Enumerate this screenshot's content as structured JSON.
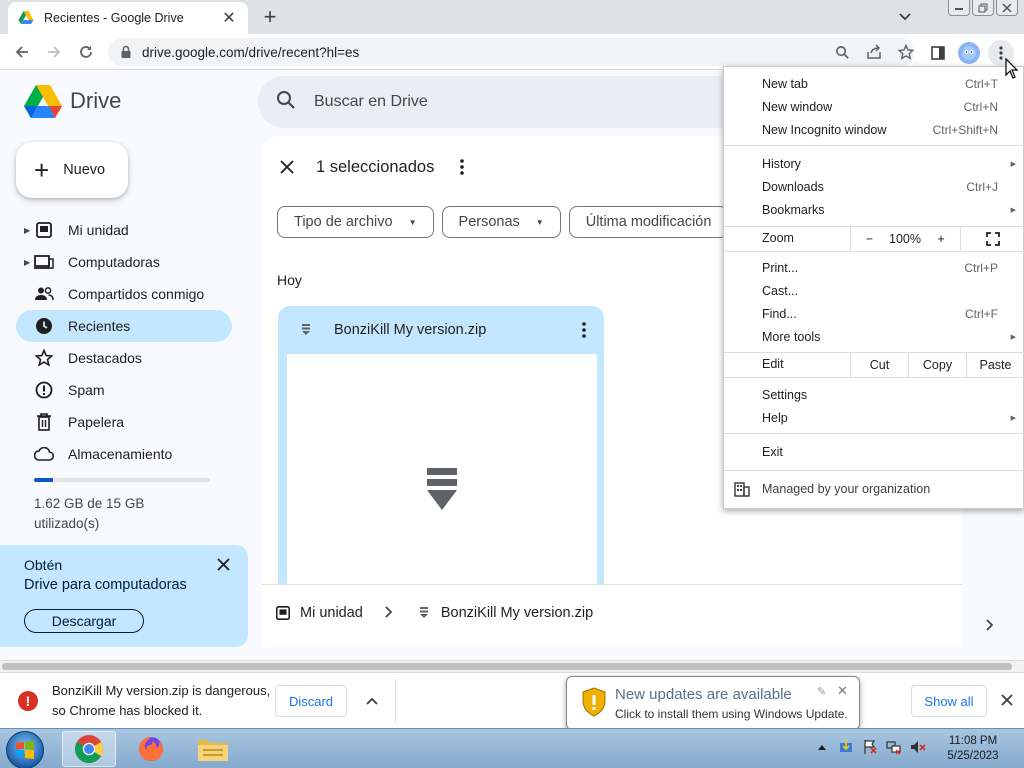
{
  "browser": {
    "tab_title": "Recientes - Google Drive",
    "url": "drive.google.com/drive/recent?hl=es"
  },
  "drive": {
    "logo_text": "Drive",
    "search_placeholder": "Buscar en Drive",
    "new_label": "Nuevo",
    "nav": [
      {
        "label": "Mi unidad",
        "icon": "drive-icon",
        "expandable": true
      },
      {
        "label": "Computadoras",
        "icon": "computer-icon",
        "expandable": true
      },
      {
        "label": "Compartidos conmigo",
        "icon": "people-icon",
        "expandable": false
      },
      {
        "label": "Recientes",
        "icon": "clock-icon",
        "expandable": false,
        "active": true
      },
      {
        "label": "Destacados",
        "icon": "star-icon",
        "expandable": false
      },
      {
        "label": "Spam",
        "icon": "spam-icon",
        "expandable": false
      },
      {
        "label": "Papelera",
        "icon": "trash-icon",
        "expandable": false
      },
      {
        "label": "Almacenamiento",
        "icon": "cloud-icon",
        "expandable": false
      }
    ],
    "storage_text": "1.62 GB de 15 GB utilizado(s)",
    "storage_used_fraction": 0.108,
    "promo": {
      "line1": "Obtén",
      "line2": "Drive para computadoras",
      "button": "Descargar"
    },
    "selection_text": "1 seleccionados",
    "filters": [
      "Tipo de archivo",
      "Personas",
      "Última modificación"
    ],
    "section_label": "Hoy",
    "file_name": "BonziKill My version.zip",
    "path": {
      "root": "Mi unidad",
      "file": "BonziKill My version.zip"
    }
  },
  "chrome_menu": {
    "group1": [
      {
        "label": "New tab",
        "shortcut": "Ctrl+T"
      },
      {
        "label": "New window",
        "shortcut": "Ctrl+N"
      },
      {
        "label": "New Incognito window",
        "shortcut": "Ctrl+Shift+N"
      }
    ],
    "group2": [
      {
        "label": "History",
        "shortcut": "",
        "submenu": true
      },
      {
        "label": "Downloads",
        "shortcut": "Ctrl+J",
        "submenu": false
      },
      {
        "label": "Bookmarks",
        "shortcut": "",
        "submenu": true
      }
    ],
    "zoom": {
      "label": "Zoom",
      "minus": "−",
      "value": "100%",
      "plus": "+"
    },
    "group3": [
      {
        "label": "Print...",
        "shortcut": "Ctrl+P",
        "submenu": false
      },
      {
        "label": "Cast...",
        "shortcut": "",
        "submenu": false
      },
      {
        "label": "Find...",
        "shortcut": "Ctrl+F",
        "submenu": false
      },
      {
        "label": "More tools",
        "shortcut": "",
        "submenu": true
      }
    ],
    "edit": {
      "label": "Edit",
      "cut": "Cut",
      "copy": "Copy",
      "paste": "Paste"
    },
    "group4": [
      {
        "label": "Settings",
        "submenu": false
      },
      {
        "label": "Help",
        "submenu": true
      }
    ],
    "exit": "Exit",
    "managed": "Managed by your organization"
  },
  "download_shelf": {
    "message": "BonziKill My version.zip is dangerous, so Chrome has blocked it.",
    "discard": "Discard",
    "show_all": "Show all"
  },
  "balloon": {
    "title": "New updates are available",
    "subtitle": "Click to install them using Windows Update."
  },
  "taskbar": {
    "time": "11:08 PM",
    "date": "5/25/2023"
  },
  "colors": {
    "active_nav": "#c2e7ff",
    "accent_blue": "#1a73e8",
    "danger_red": "#d93025"
  }
}
